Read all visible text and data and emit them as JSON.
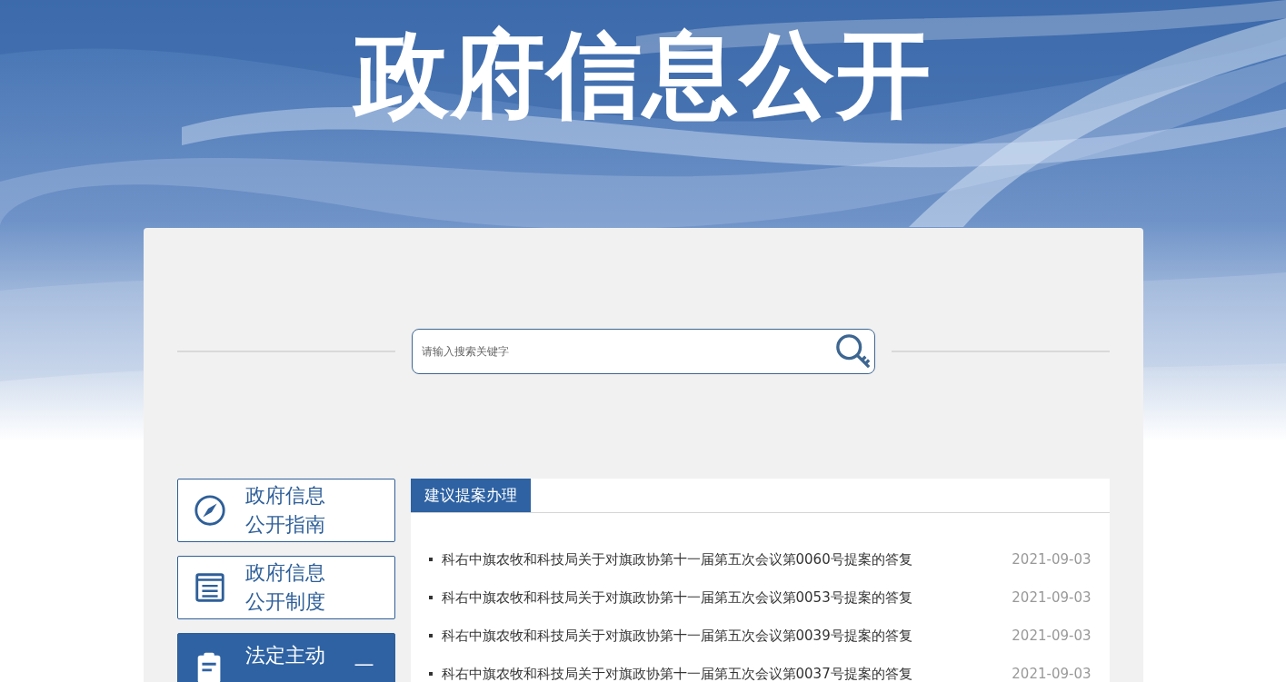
{
  "banner": {
    "title": "政府信息公开"
  },
  "search": {
    "placeholder": "请输入搜索关键字"
  },
  "sidebar": {
    "items": [
      {
        "kind": "compass",
        "lines": [
          "政府信息",
          "公开指南"
        ],
        "selected": false
      },
      {
        "kind": "list",
        "lines": [
          "政府信息",
          "公开制度"
        ],
        "selected": false
      },
      {
        "kind": "clipboard",
        "lines": [
          "法定主动"
        ],
        "selected": true,
        "toggle": "—"
      }
    ]
  },
  "panel": {
    "tab": "建议提案办理",
    "items": [
      {
        "title": "科右中旗农牧和科技局关于对旗政协第十一届第五次会议第0060号提案的答复",
        "date": "2021-09-03"
      },
      {
        "title": "科右中旗农牧和科技局关于对旗政协第十一届第五次会议第0053号提案的答复",
        "date": "2021-09-03"
      },
      {
        "title": "科右中旗农牧和科技局关于对旗政协第十一届第五次会议第0039号提案的答复",
        "date": "2021-09-03"
      },
      {
        "title": "科右中旗农牧和科技局关于对旗政协第十一届第五次会议第0037号提案的答复",
        "date": "2021-09-03"
      }
    ]
  }
}
